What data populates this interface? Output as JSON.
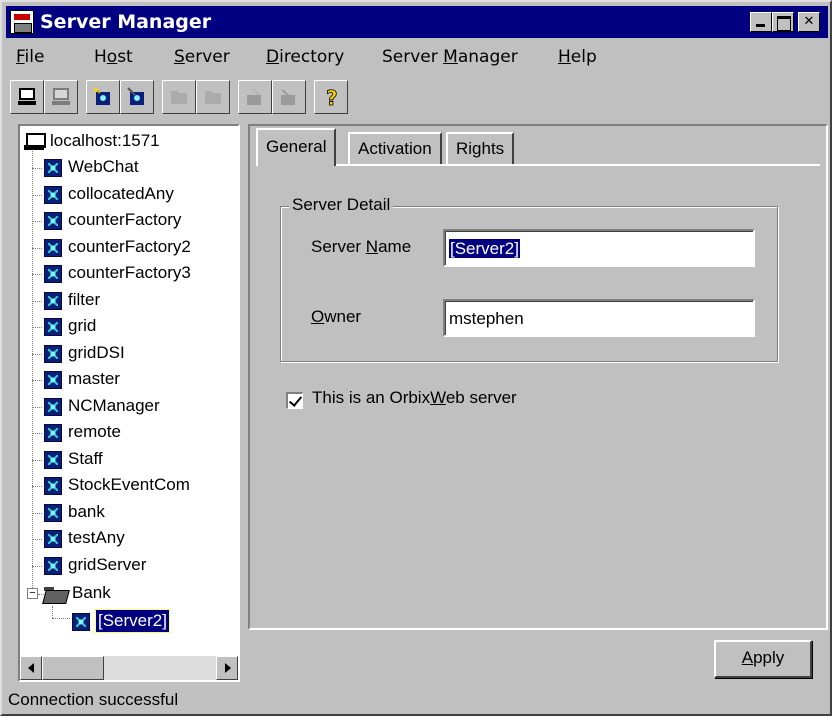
{
  "window": {
    "title": "Server Manager"
  },
  "menu": [
    {
      "label": "File",
      "accel": "F",
      "rest": "ile"
    },
    {
      "label": "Host",
      "pre": "H",
      "accel": "o",
      "rest": "st"
    },
    {
      "label": "Server",
      "accel": "S",
      "rest": "erver"
    },
    {
      "label": "Directory",
      "accel": "D",
      "rest": "irectory"
    },
    {
      "label": "Server Manager",
      "pre": "Server ",
      "accel": "M",
      "rest": "anager"
    },
    {
      "label": "Help",
      "accel": "H",
      "rest": "elp"
    }
  ],
  "toolbar": [
    {
      "icon": "new-host-icon",
      "enabled": true
    },
    {
      "icon": "remove-host-icon",
      "enabled": false
    },
    {
      "icon": "new-server-icon",
      "enabled": true
    },
    {
      "icon": "remove-server-icon",
      "enabled": true
    },
    {
      "icon": "new-folder-icon",
      "enabled": false
    },
    {
      "icon": "remove-folder-icon",
      "enabled": false
    },
    {
      "icon": "launch-icon",
      "enabled": false
    },
    {
      "icon": "kill-icon",
      "enabled": false
    },
    {
      "icon": "help-icon",
      "enabled": true
    }
  ],
  "tree": {
    "root": "localhost:1571",
    "servers": [
      "WebChat",
      "collocatedAny",
      "counterFactory",
      "counterFactory2",
      "counterFactory3",
      "filter",
      "grid",
      "gridDSI",
      "master",
      "NCManager",
      "remote",
      "Staff",
      "StockEventCom",
      "bank",
      "testAny",
      "gridServer"
    ],
    "folder": "Bank",
    "folder_child": "[Server2]"
  },
  "tabs": [
    "General",
    "Activation",
    "Rights"
  ],
  "general": {
    "group_title": "Server Detail",
    "server_name_label_pre": "Server ",
    "server_name_label_accel": "N",
    "server_name_label_rest": "ame",
    "server_name_value": "[Server2]",
    "owner_label_accel": "O",
    "owner_label_rest": "wner",
    "owner_value": "mstephen",
    "checkbox_pre": "This is an Orbix",
    "checkbox_accel": "W",
    "checkbox_rest": "eb server",
    "checkbox_checked": true
  },
  "apply": {
    "accel": "A",
    "rest": "pply"
  },
  "status": "Connection successful"
}
